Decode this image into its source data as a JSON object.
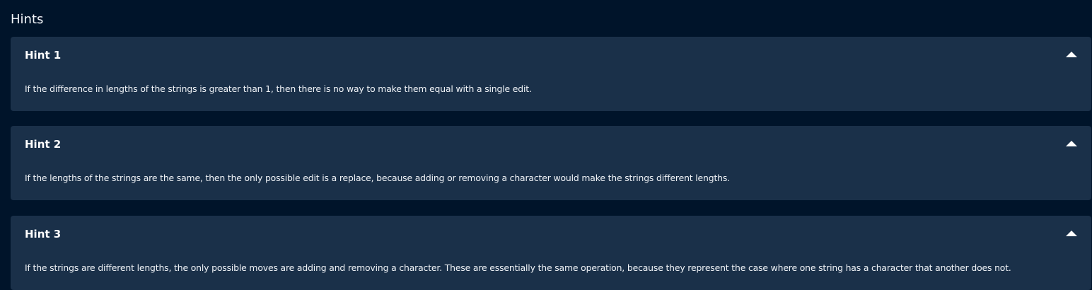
{
  "section_title": "Hints",
  "hints": [
    {
      "title": "Hint 1",
      "body": "If the difference in lengths of the strings is greater than 1, then there is no way to make them equal with a single edit.",
      "icon": "chevron-up-icon"
    },
    {
      "title": "Hint 2",
      "body": "If the lengths of the strings are the same, then the only possible edit is a replace, because adding or removing a character would make the strings different lengths.",
      "icon": "chevron-up-icon"
    },
    {
      "title": "Hint 3",
      "body": "If the strings are different lengths, the only possible moves are adding and removing a character. These are essentially the same operation, because they represent the case where one string has a character that another does not.",
      "icon": "chevron-up-icon"
    }
  ],
  "colors": {
    "background": "#00142a",
    "card": "#1a3049",
    "text": "#ffffff"
  }
}
